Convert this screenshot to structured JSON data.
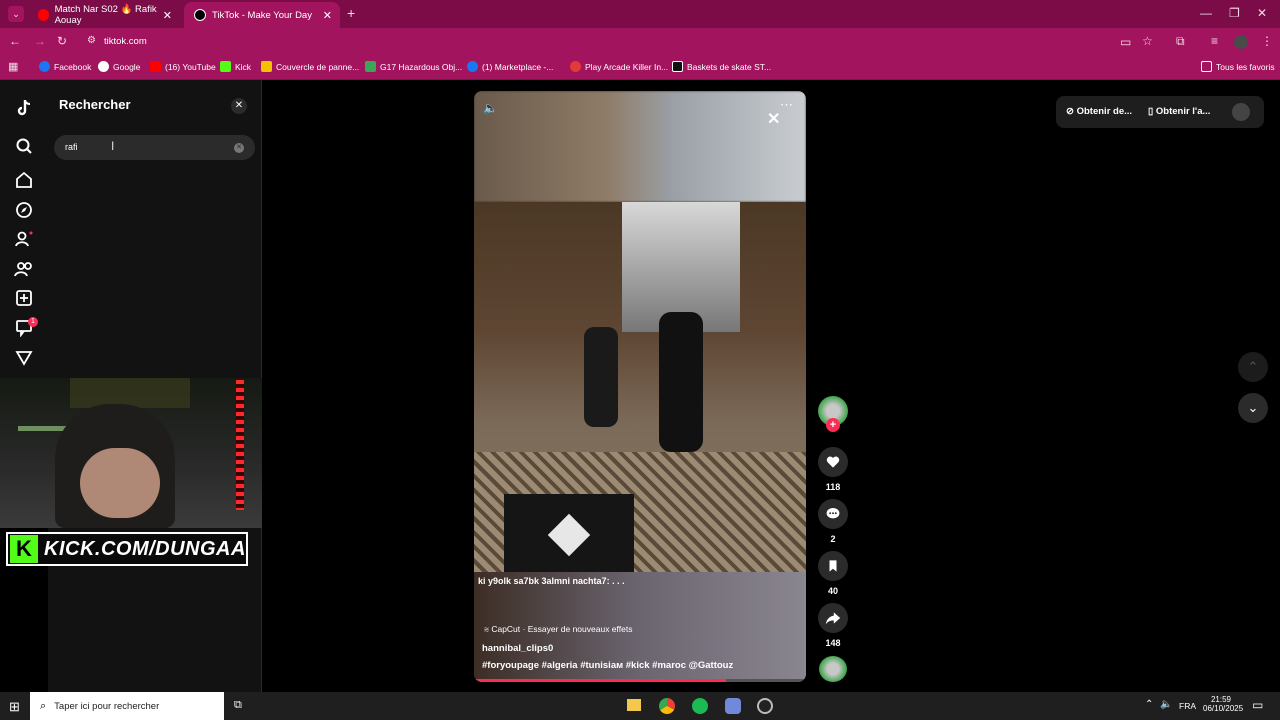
{
  "tabs": [
    {
      "title": "Match Nar S02 🔥 Rafik Aouay",
      "active": false
    },
    {
      "title": "TikTok - Make Your Day",
      "active": true
    }
  ],
  "address": "tiktok.com",
  "bookmarks": [
    "Facebook",
    "Google",
    "(16) YouTube",
    "Kick",
    "Couvercle de panne...",
    "G17 Hazardous Obj...",
    "(1) Marketplace -...",
    "Play Arcade Killer In...",
    "Baskets de skate ST..."
  ],
  "all_favorites": "Tous les favoris",
  "search": {
    "title": "Rechercher",
    "query": "rafi"
  },
  "nav_badges": {
    "inbox": "1"
  },
  "header_buttons": {
    "get_coins": "Obtenir de...",
    "get_app": "Obtenir l'a..."
  },
  "overlay": {
    "kick_text": "KICK.COM/DUNGAA"
  },
  "video": {
    "caption": "ki y9olk sa7bk 3almni nachta7: . . .",
    "effect": "CapCut · Essayer de nouveaux effets",
    "author": "hannibal_clips0",
    "tags": "#foryoupage #algeria #tunisiaᴍ #kick #maroc @Gattouz"
  },
  "counts": {
    "likes": "118",
    "comments": "2",
    "saves": "40",
    "shares": "148"
  },
  "taskbar": {
    "search_placeholder": "Taper ici pour rechercher",
    "lang": "FRA",
    "time": "21:59",
    "date": "06/10/2025"
  },
  "colors": {
    "tab_bar": "#7b0c47",
    "toolbar": "#a3145f",
    "tiktok_bg": "#121212",
    "accent": "#fe2c55"
  }
}
